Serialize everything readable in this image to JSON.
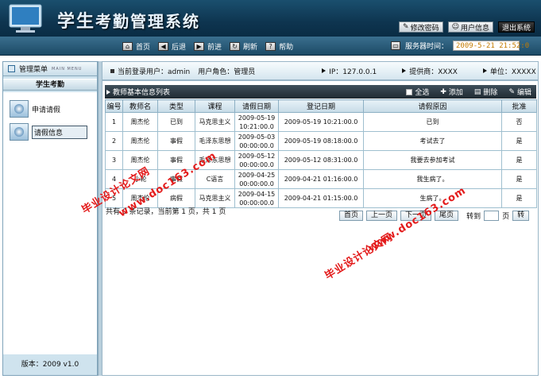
{
  "header": {
    "title_part1": "学生",
    "title_part2": "考勤管理系统",
    "buttons": {
      "change_password": "修改密码",
      "user_info": "用户信息",
      "logout": "退出系统"
    }
  },
  "nav": {
    "home": "首页",
    "back": "后退",
    "forward": "前进",
    "refresh": "刷新",
    "help": "帮助",
    "server_time_label": "服务器时间：",
    "server_time": "2009-5-21 21:52:0"
  },
  "sidebar": {
    "title": "管理菜单",
    "title_en": "MAIN MENU",
    "section": "学生考勤",
    "items": [
      {
        "label": "申请请假"
      },
      {
        "label": "请假信息"
      }
    ],
    "version": "版本：2009 v1.0"
  },
  "infobar": {
    "user": "当前登录用户：admin",
    "role": "用户角色：管理员",
    "ip": "IP：127.0.0.1",
    "provider": "提供商：XXXX",
    "unit": "单位：XXXXX"
  },
  "panel": {
    "title": "教师基本信息列表",
    "select_all": "全选",
    "add": "添加",
    "delete": "删除",
    "edit": "编辑"
  },
  "table": {
    "columns": [
      "编号",
      "教师名",
      "类型",
      "课程",
      "请假日期",
      "登记日期",
      "请假原因",
      "批准"
    ],
    "rows": [
      [
        "1",
        "周杰伦",
        "已到",
        "马克思主义",
        "2009-05-19 10:21:00.0",
        "2009-05-19 10:21:00.0",
        "已到",
        "否"
      ],
      [
        "2",
        "周杰伦",
        "事假",
        "毛泽东思想",
        "2009-05-03 00:00:00.0",
        "2009-05-19 08:18:00.0",
        "考试去了",
        "是"
      ],
      [
        "3",
        "周杰伦",
        "事假",
        "毛泽东思想",
        "2009-05-12 00:00:00.0",
        "2009-05-12 08:31:00.0",
        "我要去参加考试",
        "是"
      ],
      [
        "4",
        "小轮",
        "事假",
        "C语言",
        "2009-04-25 00:00:00.0",
        "2009-04-21 01:16:00.0",
        "我生病了。",
        "是"
      ],
      [
        "5",
        "周杰伦",
        "病假",
        "马克思主义",
        "2009-04-15 00:00:00.0",
        "2009-04-21 01:15:00.0",
        "生病了。",
        "是"
      ]
    ]
  },
  "pager": {
    "summary": "共有 0 条记录，当前第 1 页，共 1 页",
    "first": "首页",
    "prev": "上一页",
    "next": "下一页",
    "last": "尾页",
    "goto": "转到",
    "page_unit": "页",
    "go": "转"
  },
  "watermarks": [
    "毕业设计论文网",
    "www.doc163.com"
  ]
}
